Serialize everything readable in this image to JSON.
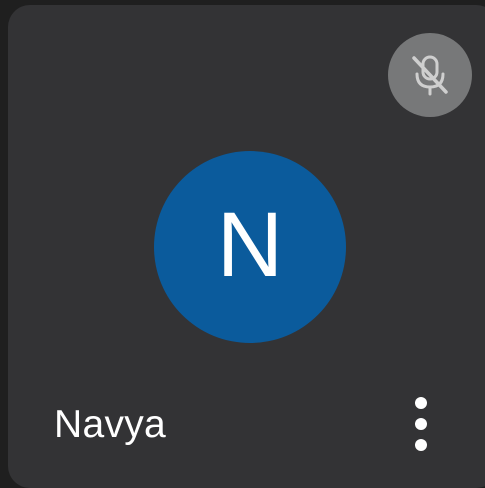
{
  "participant": {
    "name": "Navya",
    "initial": "N",
    "avatar_color": "#0b5b9c"
  },
  "status": {
    "mic_icon": "mic-off-icon",
    "mic_state": "muted"
  },
  "actions": {
    "more_icon": "more-vert-icon"
  },
  "colors": {
    "tile_background": "#333335",
    "mic_button_background": "#777879",
    "text": "#ffffff"
  }
}
